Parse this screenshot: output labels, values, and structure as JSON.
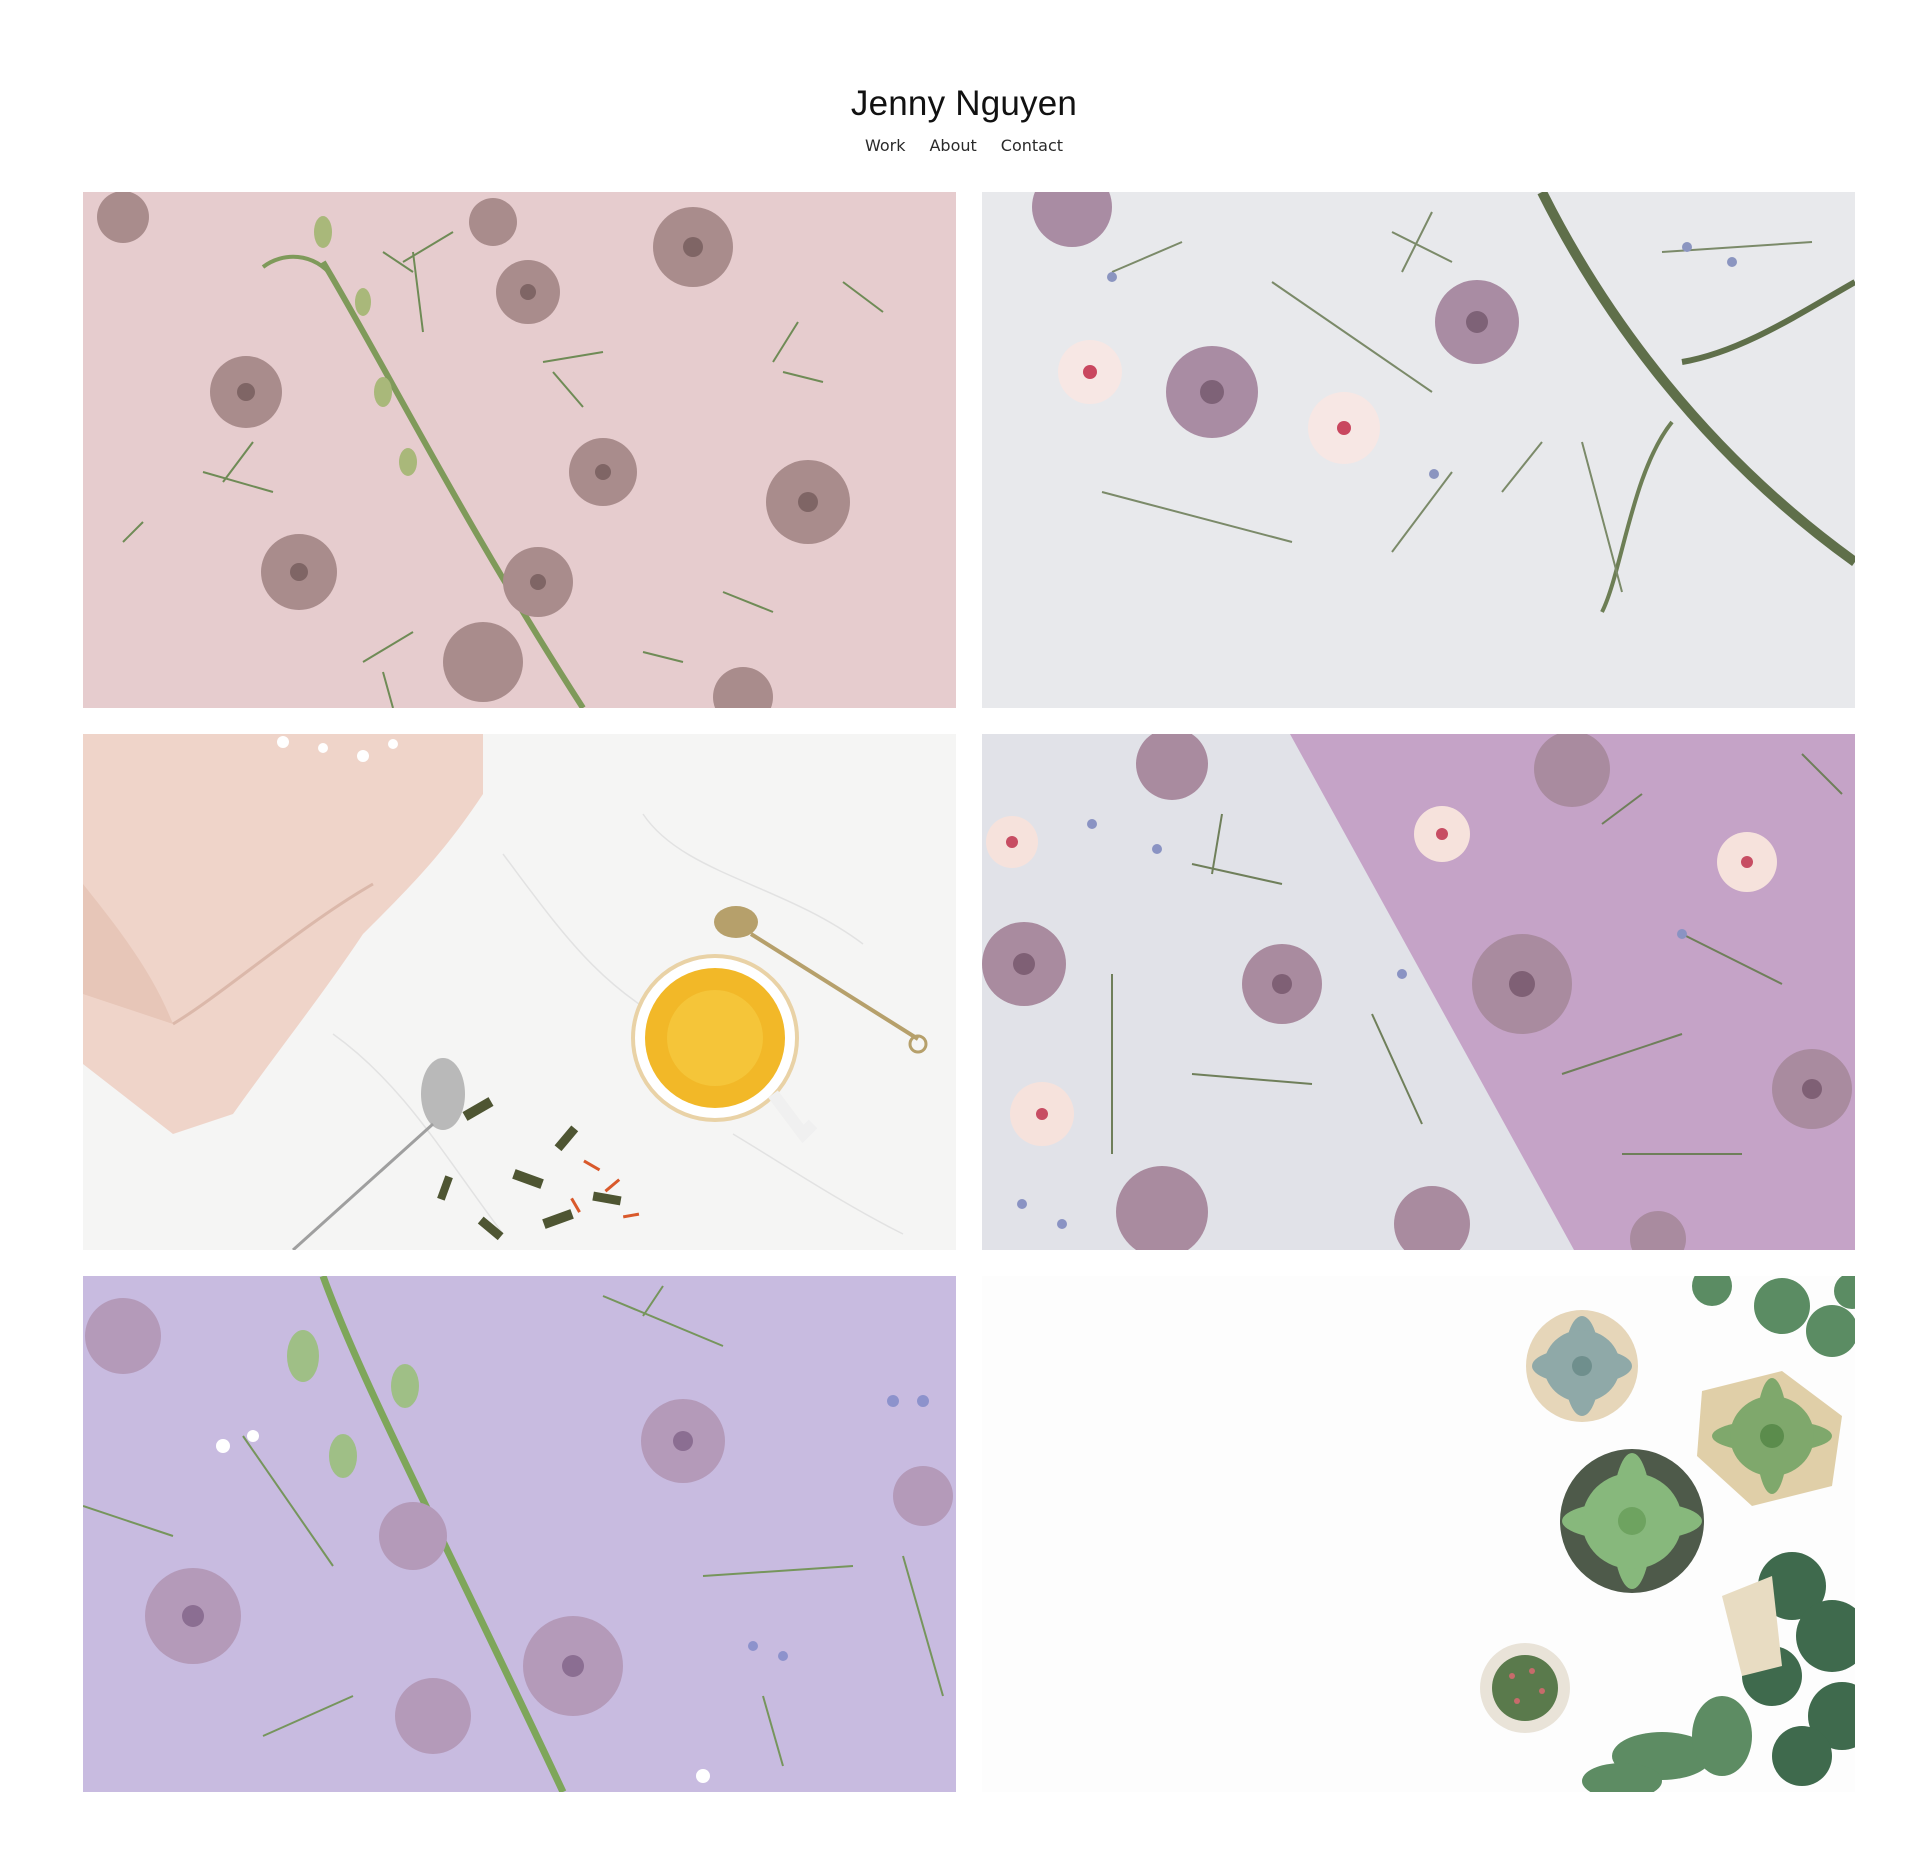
{
  "site": {
    "title": "Jenny Nguyen"
  },
  "nav": {
    "items": [
      {
        "label": "Work"
      },
      {
        "label": "About"
      },
      {
        "label": "Contact"
      }
    ]
  },
  "gallery": {
    "items": [
      {
        "subject": "pink flat-lay with dried flowers and stems",
        "background": "#e7cdd0"
      },
      {
        "subject": "light grey flat-lay with flowers and green stem",
        "background": "#e6e7ea"
      },
      {
        "subject": "marble table with tea cup, napkin and loose tea",
        "background": "#f4f4f3"
      },
      {
        "subject": "split grey and lilac flat-lay with flowers",
        "background": "#c4a3c9"
      },
      {
        "subject": "lavender flat-lay with flowers and stems",
        "background": "#c9bbe0"
      },
      {
        "subject": "white surface with succulent plants",
        "background": "#fdfdfd"
      }
    ]
  }
}
